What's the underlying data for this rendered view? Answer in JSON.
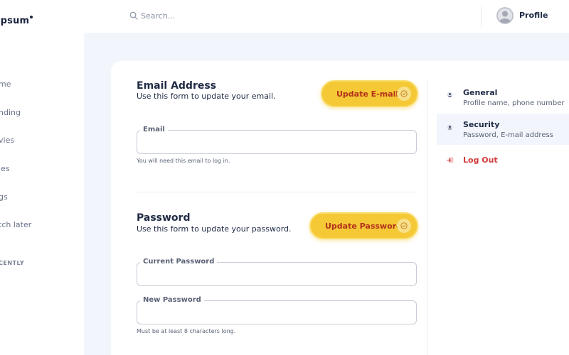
{
  "brand": {
    "logo_text": "ipsum"
  },
  "sidebar": {
    "items": [
      {
        "label": "me"
      },
      {
        "label": "nding"
      },
      {
        "label": "vies"
      },
      {
        "label": "ies"
      },
      {
        "label": "gs"
      },
      {
        "label": "tch later"
      }
    ],
    "section_label": "CENTLY"
  },
  "topbar": {
    "search_placeholder": "Search...",
    "profile_label": "Profile"
  },
  "email_section": {
    "title": "Email Address",
    "description": "Use this form to update your email.",
    "button_label": "Update E-mail",
    "field_label": "Email",
    "field_value": "",
    "hint": "You will need this email to log in."
  },
  "password_section": {
    "title": "Password",
    "description": "Use this form to update your password.",
    "button_label": "Update Password",
    "current_label": "Current Password",
    "current_value": "",
    "new_label": "New Password",
    "new_value": "",
    "hint": "Must be at least 8 characters long."
  },
  "settings_menu": {
    "items": [
      {
        "title": "General",
        "subtitle": "Profile name, phone number"
      },
      {
        "title": "Security",
        "subtitle": "Password, E-mail address"
      }
    ],
    "logout_label": "Log Out"
  },
  "colors": {
    "accent": "#f4c935",
    "button_text": "#b3301c",
    "danger": "#d33a3a",
    "background": "#f2f6fc",
    "text_primary": "#1f2a44"
  },
  "icons": {
    "search": "search-icon",
    "avatar": "user-avatar-icon",
    "check": "check-circle-icon",
    "general": "user-icon",
    "security": "user-icon",
    "logout": "logout-icon"
  }
}
